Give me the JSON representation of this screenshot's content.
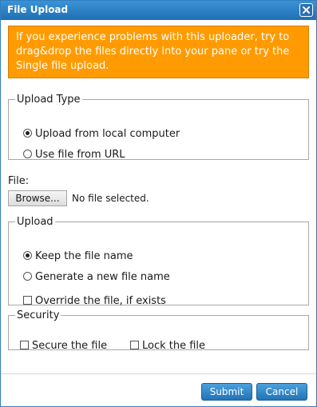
{
  "window": {
    "title": "File Upload",
    "close_icon": "close-icon"
  },
  "warning": {
    "text": "If you experience problems with this uploader, try to drag&drop the files directly into your pane or try the Single file upload."
  },
  "upload_type": {
    "legend": "Upload Type",
    "options": [
      {
        "label": "Upload from local computer",
        "selected": true
      },
      {
        "label": "Use file from URL",
        "selected": false
      }
    ]
  },
  "file": {
    "label": "File:",
    "browse_label": "Browse...",
    "status": "No file selected."
  },
  "upload": {
    "legend": "Upload",
    "options": [
      {
        "label": "Keep the file name",
        "selected": true
      },
      {
        "label": "Generate a new file name",
        "selected": false
      }
    ],
    "override": {
      "label": "Override the file, if exists",
      "checked": false
    }
  },
  "security": {
    "legend": "Security",
    "secure": {
      "label": "Secure the file",
      "checked": false
    },
    "lock": {
      "label": "Lock the file",
      "checked": false
    }
  },
  "buttons": {
    "submit": "Submit",
    "cancel": "Cancel"
  },
  "colors": {
    "titlebar": "#2a7fc4",
    "warning_bg": "#ff9b00",
    "button": "#2f86c8"
  }
}
